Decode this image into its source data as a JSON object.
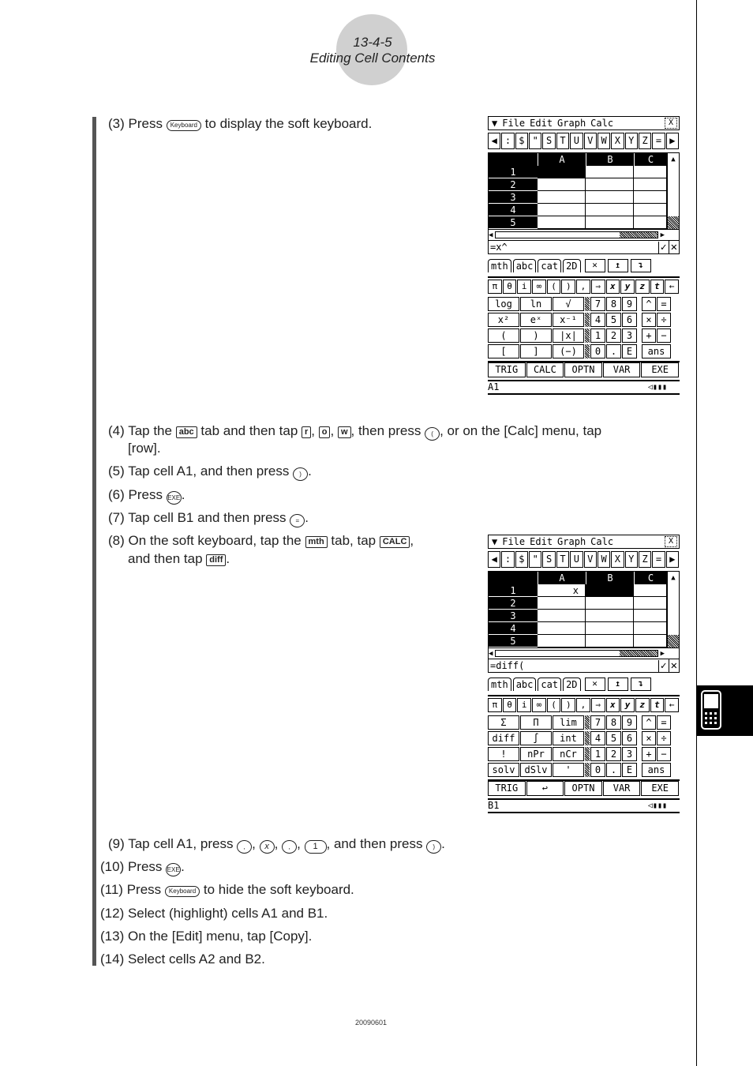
{
  "header": {
    "section": "13-4-5",
    "title": "Editing Cell Contents"
  },
  "footer": {
    "code": "20090601"
  },
  "steps": [
    {
      "num": "(3)",
      "parts": [
        "Press ",
        "Keyboard",
        " to display the soft keyboard."
      ]
    },
    {
      "num": "(4)",
      "line1_a": "Tap the ",
      "key_abc": "abc",
      "line1_b": " tab and then tap ",
      "key_r": "r",
      "key_o": "o",
      "key_w": "w",
      "line1_c": ", then press ",
      "key_open": "(",
      "line1_d": ", or on the [Calc] menu, tap",
      "line2": "[row]."
    },
    {
      "num": "(5)",
      "a": "Tap cell A1, and then press ",
      "key": ")",
      "b": "."
    },
    {
      "num": "(6)",
      "a": "Press ",
      "key": "EXE",
      "b": "."
    },
    {
      "num": "(7)",
      "a": "Tap cell B1 and then press ",
      "key": "=",
      "b": "."
    },
    {
      "num": "(8)",
      "a": "On the soft keyboard, tap the ",
      "key_mth": "mth",
      "b": " tab, tap ",
      "key_calc": "CALC",
      "c": ",",
      "line2_a": "and then tap ",
      "key_diff": "diff",
      "line2_b": "."
    },
    {
      "num": "(9)",
      "a": "Tap cell A1, press ",
      "k1": ",",
      "k2": "x",
      "k3": ",",
      "k4": "1",
      "b": ", and then press ",
      "k5": ")",
      "c": "."
    },
    {
      "num": "(10)",
      "a": "Press ",
      "key": "EXE",
      "b": "."
    },
    {
      "num": "(11)",
      "a": "Press ",
      "key": "Keyboard",
      "b": " to hide the soft keyboard."
    },
    {
      "num": "(12)",
      "a": "Select (highlight) cells A1 and B1."
    },
    {
      "num": "(13)",
      "a": "On the [Edit] menu, tap [Copy]."
    },
    {
      "num": "(14)",
      "a": "Select cells A2 and B2."
    }
  ],
  "calc": {
    "menu": [
      "File",
      "Edit",
      "Graph",
      "Calc"
    ],
    "menu_icon": "▼",
    "close": "X",
    "charbar": [
      "◀",
      ":",
      "$",
      "\"",
      "S",
      "T",
      "U",
      "V",
      "W",
      "X",
      "Y",
      "Z",
      "=",
      "▶"
    ],
    "columns": [
      "A",
      "B",
      "C"
    ],
    "rows": [
      "1",
      "2",
      "3",
      "4",
      "5"
    ],
    "tabs": [
      "mth",
      "abc",
      "cat",
      "2D"
    ],
    "tab_buttons": [
      "✕",
      "↥",
      "↴"
    ],
    "symrow": [
      "π",
      "θ",
      "i",
      "∞",
      "(",
      ")",
      ",",
      "⇒",
      "x",
      "y",
      "z",
      "t",
      "←"
    ],
    "func_keys_1": [
      "TRIG",
      "CALC",
      "OPTN",
      "VAR",
      "EXE"
    ],
    "func_keys_2": [
      "TRIG",
      "↩",
      "OPTN",
      "VAR",
      "EXE"
    ],
    "screen1": {
      "entry": "=x^",
      "status": "A1",
      "keypad": [
        [
          "log",
          "ln",
          "√",
          "7",
          "8",
          "9",
          "^",
          "="
        ],
        [
          "x²",
          "eˣ",
          "x⁻¹",
          "4",
          "5",
          "6",
          "×",
          "÷"
        ],
        [
          "(",
          ")",
          "|x|",
          "1",
          "2",
          "3",
          "+",
          "−"
        ],
        [
          "[",
          "]",
          "(−)",
          "0",
          ".",
          "E",
          "ans"
        ]
      ],
      "a1": "",
      "b1": ""
    },
    "screen2": {
      "entry": "=diff(",
      "status": "B1",
      "keypad": [
        [
          "Σ",
          "Π",
          "lim",
          "7",
          "8",
          "9",
          "^",
          "="
        ],
        [
          "diff",
          "∫",
          "int",
          "4",
          "5",
          "6",
          "×",
          "÷"
        ],
        [
          "!",
          "nPr",
          "nCr",
          "1",
          "2",
          "3",
          "+",
          "−"
        ],
        [
          "solv",
          "dSlv",
          "'",
          "0",
          ".",
          "E",
          "ans"
        ]
      ],
      "a1": "x",
      "b1": ""
    },
    "ok": "✓",
    "cancel": "✕",
    "battery": "▭"
  }
}
